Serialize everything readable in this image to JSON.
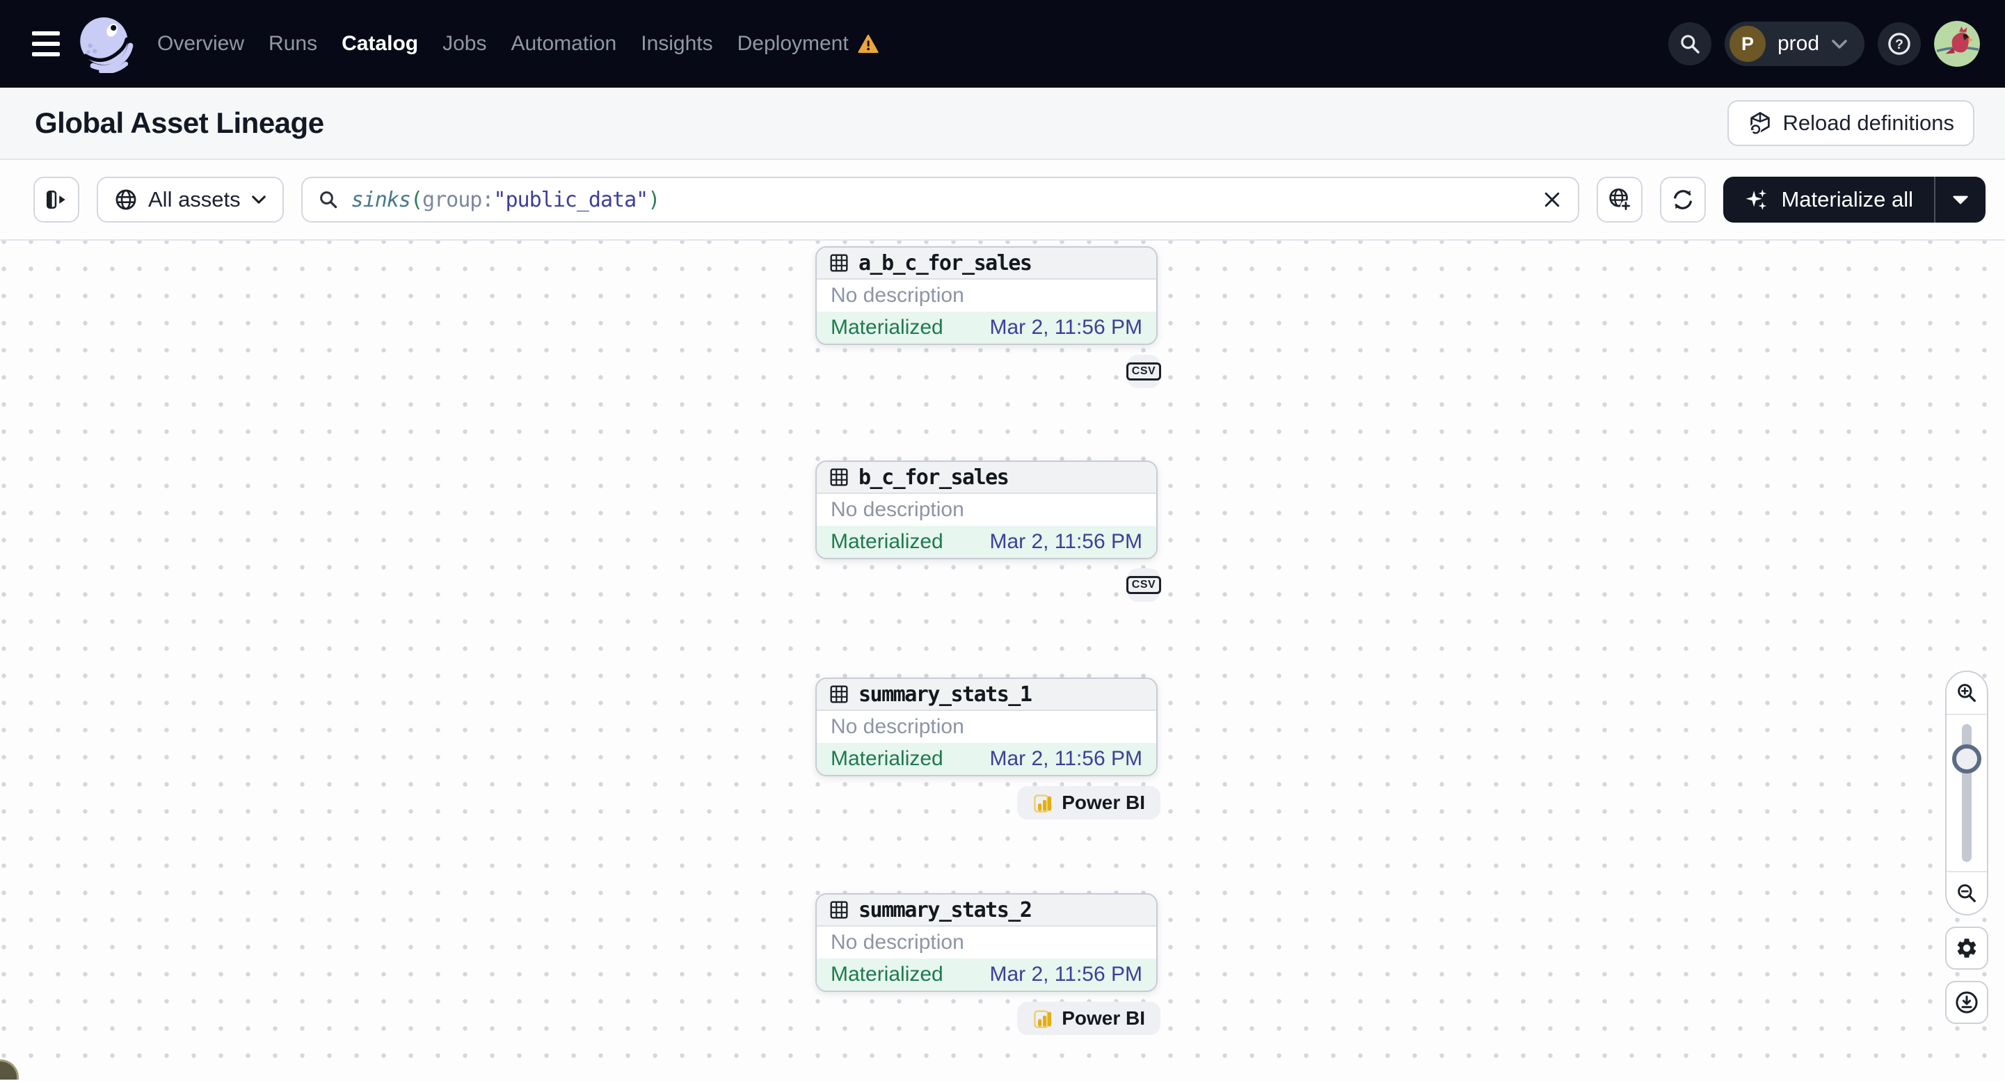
{
  "colors": {
    "nav_background": "#070a16",
    "accent_dark": "#131724",
    "status_materialized_text": "#1e7a4e",
    "status_materialized_bg": "#e7f6ee",
    "timestamp_indigo": "#3c4198",
    "warning_orange": "#eda43b",
    "powerbi_gold": "#e5ae0e",
    "query_function_teal": "#47798c",
    "query_string_indigo": "#3c3f9c"
  },
  "nav": {
    "items": [
      {
        "label": "Overview"
      },
      {
        "label": "Runs"
      },
      {
        "label": "Catalog",
        "active": true
      },
      {
        "label": "Jobs"
      },
      {
        "label": "Automation"
      },
      {
        "label": "Insights"
      },
      {
        "label": "Deployment",
        "warning": true
      }
    ],
    "environment": {
      "initial": "P",
      "name": "prod"
    }
  },
  "header": {
    "title": "Global Asset Lineage",
    "reload_button": "Reload definitions"
  },
  "toolbar": {
    "asset_scope": "All assets",
    "search_query": {
      "function": "sinks",
      "open_paren": "(",
      "key": "group",
      "colon": ":",
      "value": "\"public_data\"",
      "close_paren": ")"
    },
    "materialize_button": "Materialize all"
  },
  "graph": {
    "nodes": [
      {
        "name": "a_b_c_for_sales",
        "description": "No description",
        "status": "Materialized",
        "timestamp": "Mar 2, 11:56 PM",
        "tag": "CSV"
      },
      {
        "name": "b_c_for_sales",
        "description": "No description",
        "status": "Materialized",
        "timestamp": "Mar 2, 11:56 PM",
        "tag": "CSV"
      },
      {
        "name": "summary_stats_1",
        "description": "No description",
        "status": "Materialized",
        "timestamp": "Mar 2, 11:56 PM",
        "tag": "Power BI"
      },
      {
        "name": "summary_stats_2",
        "description": "No description",
        "status": "Materialized",
        "timestamp": "Mar 2, 11:56 PM",
        "tag": "Power BI"
      }
    ]
  }
}
